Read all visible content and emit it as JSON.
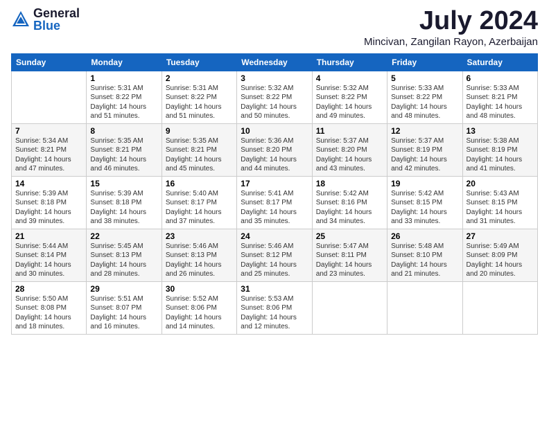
{
  "logo": {
    "general": "General",
    "blue": "Blue"
  },
  "title": "July 2024",
  "location": "Mincivan, Zangilan Rayon, Azerbaijan",
  "weekdays": [
    "Sunday",
    "Monday",
    "Tuesday",
    "Wednesday",
    "Thursday",
    "Friday",
    "Saturday"
  ],
  "weeks": [
    [
      {
        "day": "",
        "sunrise": "",
        "sunset": "",
        "daylight": ""
      },
      {
        "day": "1",
        "sunrise": "Sunrise: 5:31 AM",
        "sunset": "Sunset: 8:22 PM",
        "daylight": "Daylight: 14 hours and 51 minutes."
      },
      {
        "day": "2",
        "sunrise": "Sunrise: 5:31 AM",
        "sunset": "Sunset: 8:22 PM",
        "daylight": "Daylight: 14 hours and 51 minutes."
      },
      {
        "day": "3",
        "sunrise": "Sunrise: 5:32 AM",
        "sunset": "Sunset: 8:22 PM",
        "daylight": "Daylight: 14 hours and 50 minutes."
      },
      {
        "day": "4",
        "sunrise": "Sunrise: 5:32 AM",
        "sunset": "Sunset: 8:22 PM",
        "daylight": "Daylight: 14 hours and 49 minutes."
      },
      {
        "day": "5",
        "sunrise": "Sunrise: 5:33 AM",
        "sunset": "Sunset: 8:22 PM",
        "daylight": "Daylight: 14 hours and 48 minutes."
      },
      {
        "day": "6",
        "sunrise": "Sunrise: 5:33 AM",
        "sunset": "Sunset: 8:21 PM",
        "daylight": "Daylight: 14 hours and 48 minutes."
      }
    ],
    [
      {
        "day": "7",
        "sunrise": "Sunrise: 5:34 AM",
        "sunset": "Sunset: 8:21 PM",
        "daylight": "Daylight: 14 hours and 47 minutes."
      },
      {
        "day": "8",
        "sunrise": "Sunrise: 5:35 AM",
        "sunset": "Sunset: 8:21 PM",
        "daylight": "Daylight: 14 hours and 46 minutes."
      },
      {
        "day": "9",
        "sunrise": "Sunrise: 5:35 AM",
        "sunset": "Sunset: 8:21 PM",
        "daylight": "Daylight: 14 hours and 45 minutes."
      },
      {
        "day": "10",
        "sunrise": "Sunrise: 5:36 AM",
        "sunset": "Sunset: 8:20 PM",
        "daylight": "Daylight: 14 hours and 44 minutes."
      },
      {
        "day": "11",
        "sunrise": "Sunrise: 5:37 AM",
        "sunset": "Sunset: 8:20 PM",
        "daylight": "Daylight: 14 hours and 43 minutes."
      },
      {
        "day": "12",
        "sunrise": "Sunrise: 5:37 AM",
        "sunset": "Sunset: 8:19 PM",
        "daylight": "Daylight: 14 hours and 42 minutes."
      },
      {
        "day": "13",
        "sunrise": "Sunrise: 5:38 AM",
        "sunset": "Sunset: 8:19 PM",
        "daylight": "Daylight: 14 hours and 41 minutes."
      }
    ],
    [
      {
        "day": "14",
        "sunrise": "Sunrise: 5:39 AM",
        "sunset": "Sunset: 8:18 PM",
        "daylight": "Daylight: 14 hours and 39 minutes."
      },
      {
        "day": "15",
        "sunrise": "Sunrise: 5:39 AM",
        "sunset": "Sunset: 8:18 PM",
        "daylight": "Daylight: 14 hours and 38 minutes."
      },
      {
        "day": "16",
        "sunrise": "Sunrise: 5:40 AM",
        "sunset": "Sunset: 8:17 PM",
        "daylight": "Daylight: 14 hours and 37 minutes."
      },
      {
        "day": "17",
        "sunrise": "Sunrise: 5:41 AM",
        "sunset": "Sunset: 8:17 PM",
        "daylight": "Daylight: 14 hours and 35 minutes."
      },
      {
        "day": "18",
        "sunrise": "Sunrise: 5:42 AM",
        "sunset": "Sunset: 8:16 PM",
        "daylight": "Daylight: 14 hours and 34 minutes."
      },
      {
        "day": "19",
        "sunrise": "Sunrise: 5:42 AM",
        "sunset": "Sunset: 8:15 PM",
        "daylight": "Daylight: 14 hours and 33 minutes."
      },
      {
        "day": "20",
        "sunrise": "Sunrise: 5:43 AM",
        "sunset": "Sunset: 8:15 PM",
        "daylight": "Daylight: 14 hours and 31 minutes."
      }
    ],
    [
      {
        "day": "21",
        "sunrise": "Sunrise: 5:44 AM",
        "sunset": "Sunset: 8:14 PM",
        "daylight": "Daylight: 14 hours and 30 minutes."
      },
      {
        "day": "22",
        "sunrise": "Sunrise: 5:45 AM",
        "sunset": "Sunset: 8:13 PM",
        "daylight": "Daylight: 14 hours and 28 minutes."
      },
      {
        "day": "23",
        "sunrise": "Sunrise: 5:46 AM",
        "sunset": "Sunset: 8:13 PM",
        "daylight": "Daylight: 14 hours and 26 minutes."
      },
      {
        "day": "24",
        "sunrise": "Sunrise: 5:46 AM",
        "sunset": "Sunset: 8:12 PM",
        "daylight": "Daylight: 14 hours and 25 minutes."
      },
      {
        "day": "25",
        "sunrise": "Sunrise: 5:47 AM",
        "sunset": "Sunset: 8:11 PM",
        "daylight": "Daylight: 14 hours and 23 minutes."
      },
      {
        "day": "26",
        "sunrise": "Sunrise: 5:48 AM",
        "sunset": "Sunset: 8:10 PM",
        "daylight": "Daylight: 14 hours and 21 minutes."
      },
      {
        "day": "27",
        "sunrise": "Sunrise: 5:49 AM",
        "sunset": "Sunset: 8:09 PM",
        "daylight": "Daylight: 14 hours and 20 minutes."
      }
    ],
    [
      {
        "day": "28",
        "sunrise": "Sunrise: 5:50 AM",
        "sunset": "Sunset: 8:08 PM",
        "daylight": "Daylight: 14 hours and 18 minutes."
      },
      {
        "day": "29",
        "sunrise": "Sunrise: 5:51 AM",
        "sunset": "Sunset: 8:07 PM",
        "daylight": "Daylight: 14 hours and 16 minutes."
      },
      {
        "day": "30",
        "sunrise": "Sunrise: 5:52 AM",
        "sunset": "Sunset: 8:06 PM",
        "daylight": "Daylight: 14 hours and 14 minutes."
      },
      {
        "day": "31",
        "sunrise": "Sunrise: 5:53 AM",
        "sunset": "Sunset: 8:06 PM",
        "daylight": "Daylight: 14 hours and 12 minutes."
      },
      {
        "day": "",
        "sunrise": "",
        "sunset": "",
        "daylight": ""
      },
      {
        "day": "",
        "sunrise": "",
        "sunset": "",
        "daylight": ""
      },
      {
        "day": "",
        "sunrise": "",
        "sunset": "",
        "daylight": ""
      }
    ]
  ]
}
